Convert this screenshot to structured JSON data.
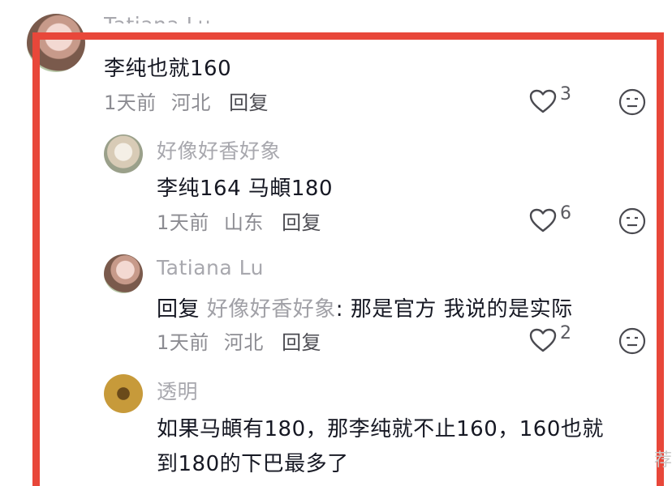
{
  "comments": [
    {
      "author": "Tatiana Lu",
      "text": "李纯也就160",
      "time": "1天前",
      "location": "河北",
      "reply_label": "回复",
      "likes": "3"
    },
    {
      "author": "好像好香好象",
      "text": "李纯164  马頔180",
      "time": "1天前",
      "location": "山东",
      "reply_label": "回复",
      "likes": "6"
    },
    {
      "author": "Tatiana Lu",
      "reply_prefix": "回复",
      "mention": "好像好香好象",
      "text": ": 那是官方 我说的是实际",
      "time": "1天前",
      "location": "河北",
      "reply_label": "回复",
      "likes": "2"
    },
    {
      "author": "透明",
      "text_line1": "如果马頔有180，那李纯就不止160，160也就",
      "text_line2": "到180的下巴最多了"
    }
  ],
  "watermark": "荐",
  "colors": {
    "frame": "#e8473a",
    "text": "#161823",
    "muted": "#8c8c92"
  },
  "icons": {
    "like": "heart-outline-icon",
    "dislike": "neutral-face-icon"
  }
}
